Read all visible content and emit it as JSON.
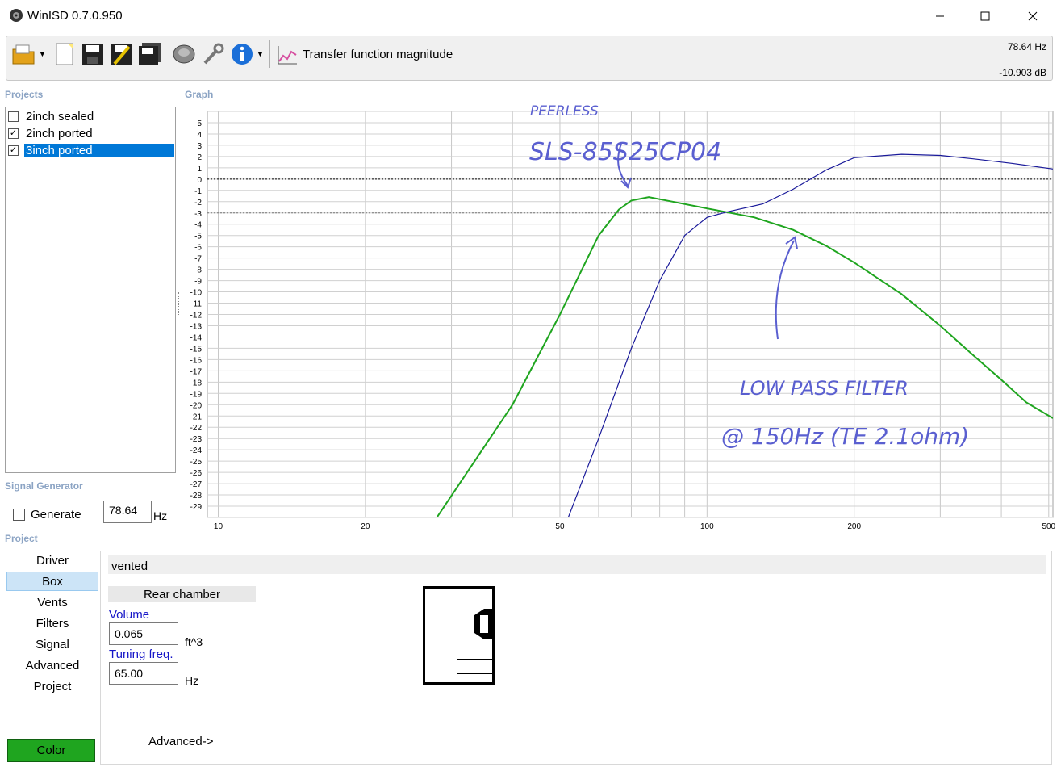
{
  "window": {
    "title": "WinISD 0.7.0.950",
    "controls": [
      "minimize-icon",
      "maximize-icon",
      "close-icon"
    ]
  },
  "toolbar": {
    "buttons": [
      "open-folder-icon",
      "new-document-icon",
      "save-icon",
      "edit-save-icon",
      "save-all-icon",
      "speaker-driver-icon",
      "wrench-icon",
      "info-icon"
    ],
    "graph_selector_icon": "graph-icon",
    "graph_selector_label": "Transfer function magnitude",
    "cursor_freq": "78.64 Hz",
    "cursor_level": "-10.903 dB"
  },
  "projects": {
    "label": "Projects",
    "items": [
      {
        "label": "2inch sealed",
        "checked": false,
        "selected": false
      },
      {
        "label": "2inch ported",
        "checked": true,
        "selected": false
      },
      {
        "label": "3inch ported",
        "checked": true,
        "selected": true
      }
    ]
  },
  "graph": {
    "label": "Graph",
    "annotations": [
      "PEERLESS",
      "SLS-85S25CP04",
      "LOW PASS FILTER",
      "@ 150Hz (TE 2.1ohm)"
    ]
  },
  "chart_data": {
    "type": "line",
    "xscale": "log",
    "xlim": [
      9.5,
      510
    ],
    "ylim": [
      -30,
      6
    ],
    "x_ticks": [
      "10",
      "20",
      "50",
      "100",
      "200",
      "500"
    ],
    "y_ticks": [
      "5",
      "4",
      "3",
      "2",
      "1",
      "0",
      "-1",
      "-2",
      "-3",
      "-4",
      "-5",
      "-6",
      "-7",
      "-8",
      "-9",
      "-10",
      "-11",
      "-12",
      "-13",
      "-14",
      "-15",
      "-16",
      "-17",
      "-18",
      "-19",
      "-20",
      "-21",
      "-22",
      "-23",
      "-24",
      "-25",
      "-26",
      "-27",
      "-28",
      "-29"
    ],
    "reference_lines": [
      0,
      -3
    ],
    "grid": true,
    "series": [
      {
        "color": "#1fa51f",
        "points": [
          [
            28,
            -30
          ],
          [
            40,
            -20
          ],
          [
            50,
            -12
          ],
          [
            60,
            -5
          ],
          [
            66,
            -2.7
          ],
          [
            70,
            -1.9
          ],
          [
            76,
            -1.6
          ],
          [
            85,
            -2
          ],
          [
            100,
            -2.6
          ],
          [
            125,
            -3.4
          ],
          [
            150,
            -4.5
          ],
          [
            175,
            -5.9
          ],
          [
            200,
            -7.4
          ],
          [
            250,
            -10.2
          ],
          [
            300,
            -13
          ],
          [
            350,
            -15.6
          ],
          [
            400,
            -17.8
          ],
          [
            450,
            -19.8
          ],
          [
            510,
            -21.2
          ]
        ]
      },
      {
        "color": "#1a1a9a",
        "points": [
          [
            52,
            -30
          ],
          [
            60,
            -23
          ],
          [
            70,
            -15
          ],
          [
            80,
            -9
          ],
          [
            90,
            -5
          ],
          [
            100,
            -3.4
          ],
          [
            110,
            -2.9
          ],
          [
            130,
            -2.2
          ],
          [
            150,
            -0.9
          ],
          [
            175,
            0.8
          ],
          [
            200,
            1.9
          ],
          [
            250,
            2.2
          ],
          [
            300,
            2.1
          ],
          [
            350,
            1.8
          ],
          [
            420,
            1.4
          ],
          [
            510,
            0.9
          ]
        ]
      }
    ]
  },
  "signal_generator": {
    "label": "Signal Generator",
    "generate_label": "Generate",
    "generate_checked": false,
    "frequency": "78.64",
    "unit": "Hz"
  },
  "project_panel": {
    "label": "Project",
    "nav": [
      "Driver",
      "Box",
      "Vents",
      "Filters",
      "Signal",
      "Advanced",
      "Project"
    ],
    "selected_nav": "Box",
    "color_button": "Color",
    "color_swatch": "#1fa51f",
    "box_type": "vented",
    "rear_chamber": "Rear chamber",
    "volume_label": "Volume",
    "volume_value": "0.065",
    "volume_unit": "ft^3",
    "tuning_label": "Tuning freq.",
    "tuning_value": "65.00",
    "tuning_unit": "Hz",
    "advanced_link": "Advanced->"
  }
}
